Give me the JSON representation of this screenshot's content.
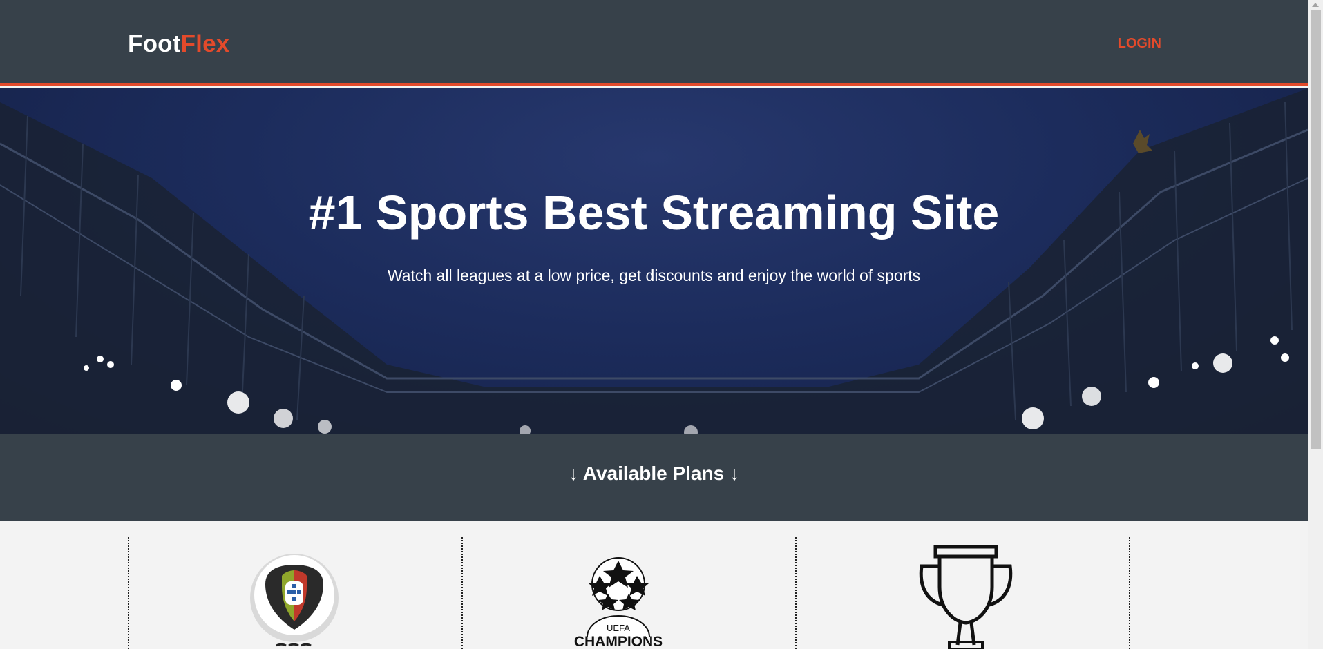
{
  "header": {
    "logo_part1": "Foot",
    "logo_part2": "Flex",
    "login_label": "LOGIN"
  },
  "hero": {
    "title": "#1 Sports Best Streaming Site",
    "subtitle": "Watch all leagues at a low price, get discounts and enjoy the world of sports"
  },
  "plans": {
    "heading": "↓ Available Plans ↓"
  },
  "cards": [
    {
      "icon": "portugal-league-logo-icon"
    },
    {
      "icon": "uefa-champions-league-logo-icon",
      "logo_text_top": "UEFA",
      "logo_text_bottom": "CHAMPIONS"
    },
    {
      "icon": "trophy-icon"
    }
  ],
  "colors": {
    "header_bg": "#37414a",
    "accent": "#e34a2b",
    "hero_bg": "#1c2c5c",
    "cards_bg": "#f3f3f3"
  }
}
